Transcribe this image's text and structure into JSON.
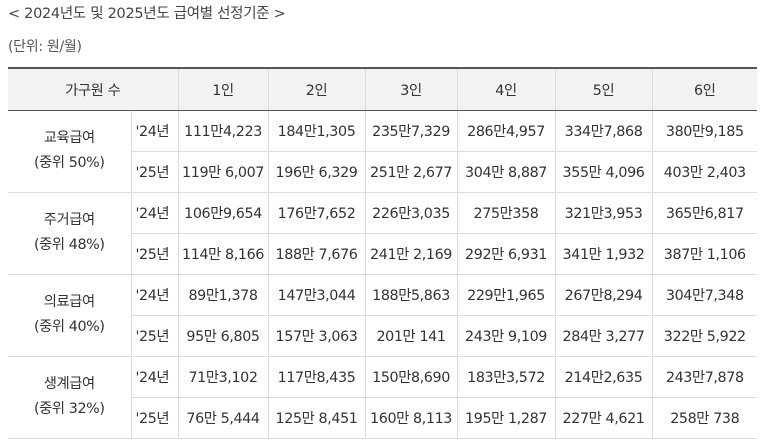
{
  "title": "< 2024년도 및 2025년도 급여별 선정기준 >",
  "unit": "(단위: 원/월)",
  "table": {
    "header": {
      "household": "가구원 수",
      "sizes": [
        "1인",
        "2인",
        "3인",
        "4인",
        "5인",
        "6인"
      ]
    },
    "groups": [
      {
        "name": "교육급여",
        "median": "(중위 50%)",
        "rows": [
          {
            "year": "'24년",
            "values": [
              "111만4,223",
              "184만1,305",
              "235만7,329",
              "286만4,957",
              "334만7,868",
              "380만9,185"
            ]
          },
          {
            "year": "'25년",
            "values": [
              "119만 6,007",
              "196만 6,329",
              "251만 2,677",
              "304만 8,887",
              "355만 4,096",
              "403만 2,403"
            ]
          }
        ]
      },
      {
        "name": "주거급여",
        "median": "(중위 48%)",
        "rows": [
          {
            "year": "'24년",
            "values": [
              "106만9,654",
              "176만7,652",
              "226만3,035",
              "275만358",
              "321만3,953",
              "365만6,817"
            ]
          },
          {
            "year": "'25년",
            "values": [
              "114만 8,166",
              "188만 7,676",
              "241만 2,169",
              "292만 6,931",
              "341만 1,932",
              "387만 1,106"
            ]
          }
        ]
      },
      {
        "name": "의료급여",
        "median": "(중위 40%)",
        "rows": [
          {
            "year": "'24년",
            "values": [
              "89만1,378",
              "147만3,044",
              "188만5,863",
              "229만1,965",
              "267만8,294",
              "304만7,348"
            ]
          },
          {
            "year": "'25년",
            "values": [
              "95만 6,805",
              "157만 3,063",
              "201만 141",
              "243만 9,109",
              "284만 3,277",
              "322만 5,922"
            ]
          }
        ]
      },
      {
        "name": "생계급여",
        "median": "(중위 32%)",
        "rows": [
          {
            "year": "'24년",
            "values": [
              "71만3,102",
              "117만8,435",
              "150만8,690",
              "183만3,572",
              "214만2,635",
              "243만7,878"
            ]
          },
          {
            "year": "'25년",
            "values": [
              "76만 5,444",
              "125만 8,451",
              "160만 8,113",
              "195만 1,287",
              "227만 4,621",
              "258만 738"
            ]
          }
        ]
      }
    ]
  }
}
